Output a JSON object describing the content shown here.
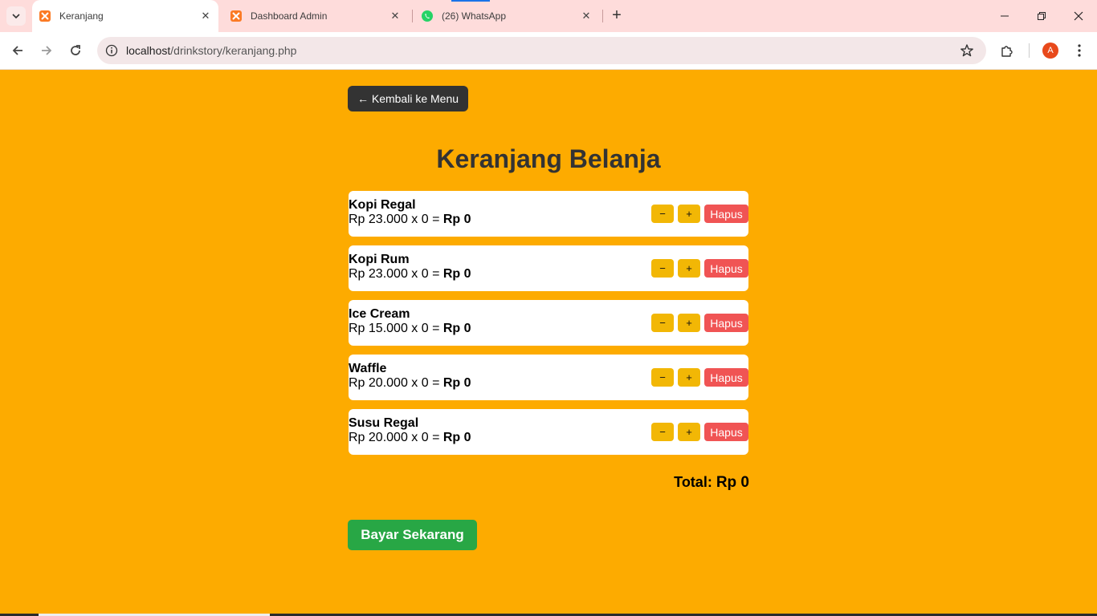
{
  "browser": {
    "tabs": [
      {
        "title": "Keranjang",
        "active": true,
        "favicon": "xampp-icon"
      },
      {
        "title": "Dashboard Admin",
        "active": false,
        "favicon": "xampp-icon"
      },
      {
        "title": "(26) WhatsApp",
        "active": false,
        "favicon": "whatsapp-icon"
      }
    ],
    "url_host": "localhost",
    "url_path": "/drinkstory/keranjang.php",
    "profile_initial": "A",
    "accent_color": "#1a73e8"
  },
  "page": {
    "back_label": "← Kembali ke Menu",
    "title": "Keranjang Belanja",
    "background": "#fdab00",
    "items": [
      {
        "name": "Kopi Regal",
        "price": "Rp 23.000 x 0 = ",
        "subtotal": "Rp 0"
      },
      {
        "name": "Kopi Rum",
        "price": "Rp 23.000 x 0 = ",
        "subtotal": "Rp 0"
      },
      {
        "name": "Ice Cream",
        "price": "Rp 15.000 x 0 = ",
        "subtotal": "Rp 0"
      },
      {
        "name": "Waffle",
        "price": "Rp 20.000 x 0 = ",
        "subtotal": "Rp 0"
      },
      {
        "name": "Susu Regal",
        "price": "Rp 20.000 x 0 = ",
        "subtotal": "Rp 0"
      }
    ],
    "minus_label": "−",
    "plus_label": "+",
    "delete_label": "Hapus",
    "total_label": "Total: ",
    "total_amount": "Rp 0",
    "pay_label": "Bayar Sekarang"
  }
}
